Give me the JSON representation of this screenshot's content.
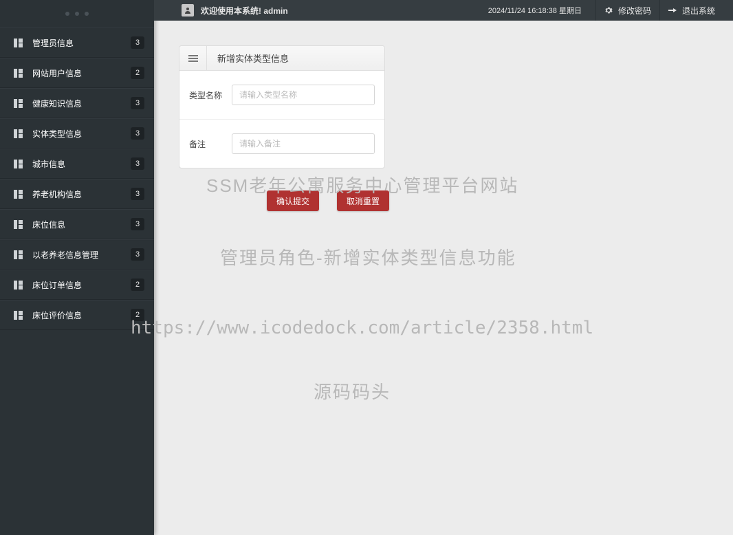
{
  "header": {
    "welcome": "欢迎使用本系统! admin",
    "timestamp": "2024/11/24 16:18:38 星期日",
    "change_pw": "修改密码",
    "logout": "退出系统"
  },
  "sidebar": {
    "items": [
      {
        "label": "管理员信息",
        "badge": "3"
      },
      {
        "label": "网站用户信息",
        "badge": "2"
      },
      {
        "label": "健康知识信息",
        "badge": "3"
      },
      {
        "label": "实体类型信息",
        "badge": "3"
      },
      {
        "label": "城市信息",
        "badge": "3"
      },
      {
        "label": "养老机构信息",
        "badge": "3"
      },
      {
        "label": "床位信息",
        "badge": "3"
      },
      {
        "label": "以老养老信息管理",
        "badge": "3"
      },
      {
        "label": "床位订单信息",
        "badge": "2"
      },
      {
        "label": "床位评价信息",
        "badge": "2"
      }
    ]
  },
  "panel": {
    "title": "新增实体类型信息",
    "row1_label": "类型名称",
    "row1_placeholder": "请输入类型名称",
    "row2_label": "备注",
    "row2_placeholder": "请输入备注",
    "submit": "确认提交",
    "reset": "取消重置"
  },
  "watermark": {
    "wm1": "SSM老年公寓服务中心管理平台网站",
    "wm2": "管理员角色-新增实体类型信息功能",
    "wm3": "https://www.icodedock.com/article/2358.html",
    "wm4": "源码码头"
  }
}
